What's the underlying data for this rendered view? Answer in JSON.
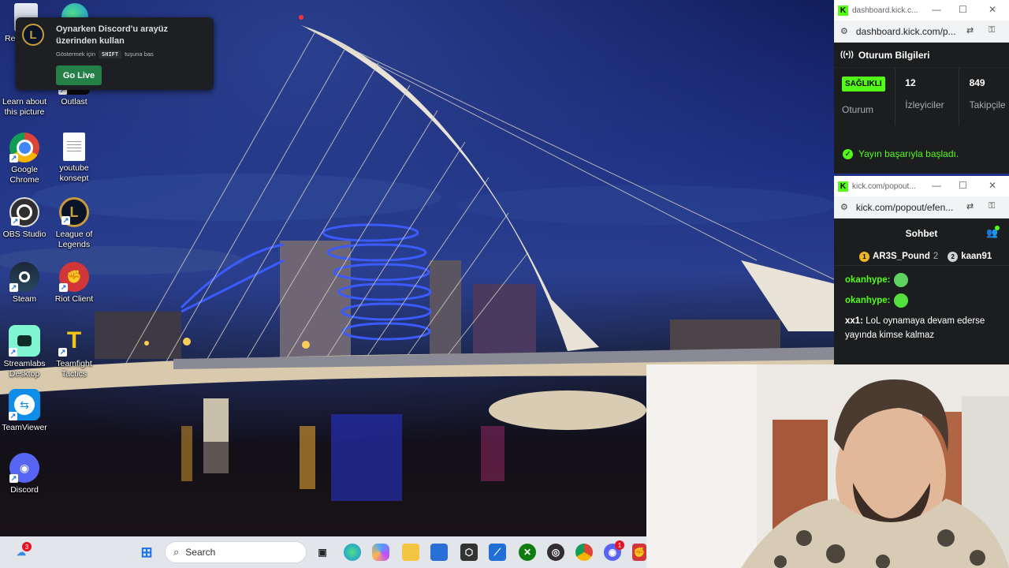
{
  "desktop": {
    "icons": [
      {
        "label": "Recycle Bin",
        "icon": "recycle-bin-icon"
      },
      {
        "label": "Microsoft Edge",
        "icon": "edge-icon"
      },
      {
        "label": "Learn about this picture",
        "icon": "camera-icon"
      },
      {
        "label": "Outlast",
        "icon": "outlast-icon"
      },
      {
        "label": "Google Chrome",
        "icon": "chrome-icon"
      },
      {
        "label": "youtube konsept",
        "icon": "text-document-icon"
      },
      {
        "label": "OBS Studio",
        "icon": "obs-icon"
      },
      {
        "label": "League of Legends",
        "icon": "league-of-legends-icon"
      },
      {
        "label": "Steam",
        "icon": "steam-icon"
      },
      {
        "label": "Riot Client",
        "icon": "riot-client-icon"
      },
      {
        "label": "Streamlabs Desktop",
        "icon": "streamlabs-icon"
      },
      {
        "label": "Teamfight Tactics",
        "icon": "teamfight-tactics-icon"
      },
      {
        "label": "TeamViewer",
        "icon": "teamviewer-icon"
      },
      {
        "label": "Discord",
        "icon": "discord-icon"
      }
    ],
    "icon_partial_label": "Rec"
  },
  "discord_overlay": {
    "title": "Oynarken Discord'u arayüz üzerinden kullan",
    "hint_prefix": "Göstermek için",
    "hint_key": "SHIFT",
    "hint_suffix": "tuşuna bas",
    "go_live_label": "Go Live",
    "accent": "#248046"
  },
  "session_window": {
    "tab_title": "dashboard.kick.c...",
    "url": "dashboard.kick.com/p...",
    "section_title": "Oturum Bilgileri",
    "status_badge": "SAĞLIKLI",
    "status_label": "Oturum",
    "viewers_value": "12",
    "viewers_label": "İzleyiciler",
    "followers_value": "849",
    "followers_label": "Takipçile",
    "success_message": "Yayın başarıyla başladı.",
    "brand_color": "#53fc18"
  },
  "chat_window": {
    "tab_title": "kick.com/popout...",
    "url": "kick.com/popout/efen...",
    "header": "Sohbet",
    "leaderboard": [
      {
        "rank": "1",
        "name": "AR3S_Pound",
        "count": "2"
      },
      {
        "rank": "2",
        "name": "kaan91",
        "count": ""
      }
    ],
    "messages": [
      {
        "user": "okanhype:",
        "text": "",
        "emote": "frog-emote-icon"
      },
      {
        "user": "okanhype:",
        "text": "",
        "emote": "smile-emote-icon"
      },
      {
        "user": "xx1:",
        "text": "LoL oynamaya devam ederse yayında kimse kalmaz",
        "emote": ""
      }
    ]
  },
  "taskbar": {
    "weather_badge": "3",
    "search_placeholder": "Search",
    "apps": [
      "start-icon",
      "file-explorer-icon",
      "edge-icon",
      "copilot-icon",
      "folder-icon",
      "store-icon",
      "chatgpt-icon",
      "visual-studio-icon",
      "xbox-icon",
      "obs-icon",
      "chrome-icon",
      "discord-icon",
      "riot-client-icon"
    ],
    "discord_badge": "1"
  }
}
